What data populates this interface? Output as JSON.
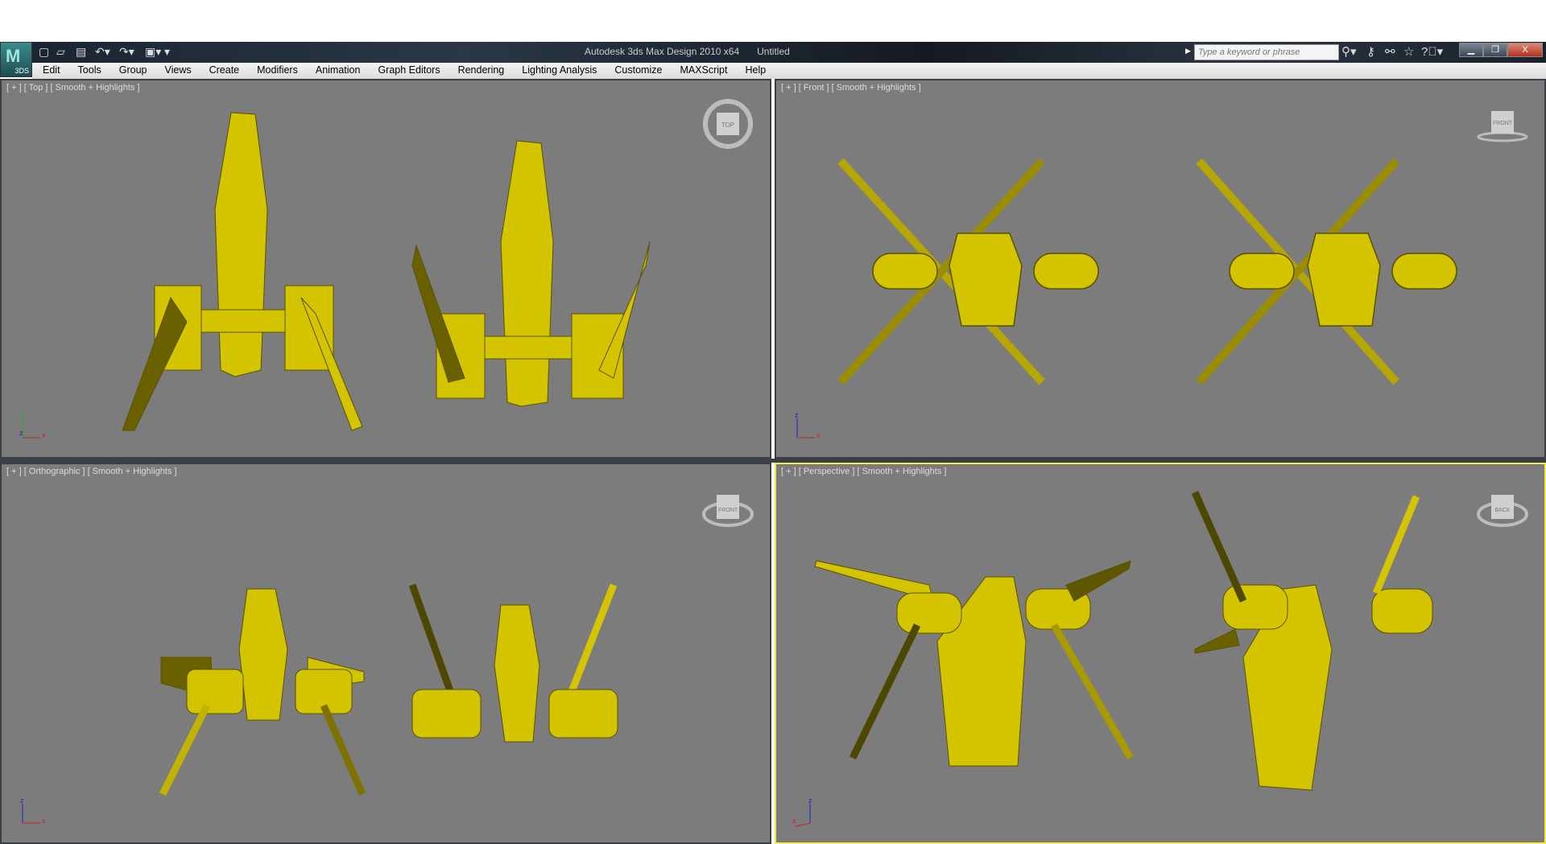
{
  "app": {
    "logo_label": "3DS",
    "title": "Autodesk 3ds Max Design 2010 x64",
    "document": "Untitled"
  },
  "search": {
    "placeholder": "Type a keyword or phrase"
  },
  "menu": [
    "Edit",
    "Tools",
    "Group",
    "Views",
    "Create",
    "Modifiers",
    "Animation",
    "Graph Editors",
    "Rendering",
    "Lighting Analysis",
    "Customize",
    "MAXScript",
    "Help"
  ],
  "viewports": [
    {
      "label": "[ + ] [ Top ] [ Smooth + Highlights ]",
      "cube": "TOP",
      "axes": [
        "y",
        "z",
        "x"
      ]
    },
    {
      "label": "[ + ] [ Front ] [ Smooth + Highlights ]",
      "cube": "FRONT",
      "axes": [
        "z",
        "",
        "x"
      ]
    },
    {
      "label": "[ + ] [ Orthographic ] [ Smooth + Highlights ]",
      "cube": "FRONT",
      "axes": [
        "z",
        "",
        "x"
      ]
    },
    {
      "label": "[ + ] [ Perspective ] [ Smooth + Highlights ]",
      "cube": "BACK",
      "axes": [
        "z",
        "",
        "x"
      ]
    }
  ],
  "colors": {
    "viewport_bg": "#7c7c7c",
    "model": "#d4c400",
    "active_border": "#f5e84a"
  }
}
